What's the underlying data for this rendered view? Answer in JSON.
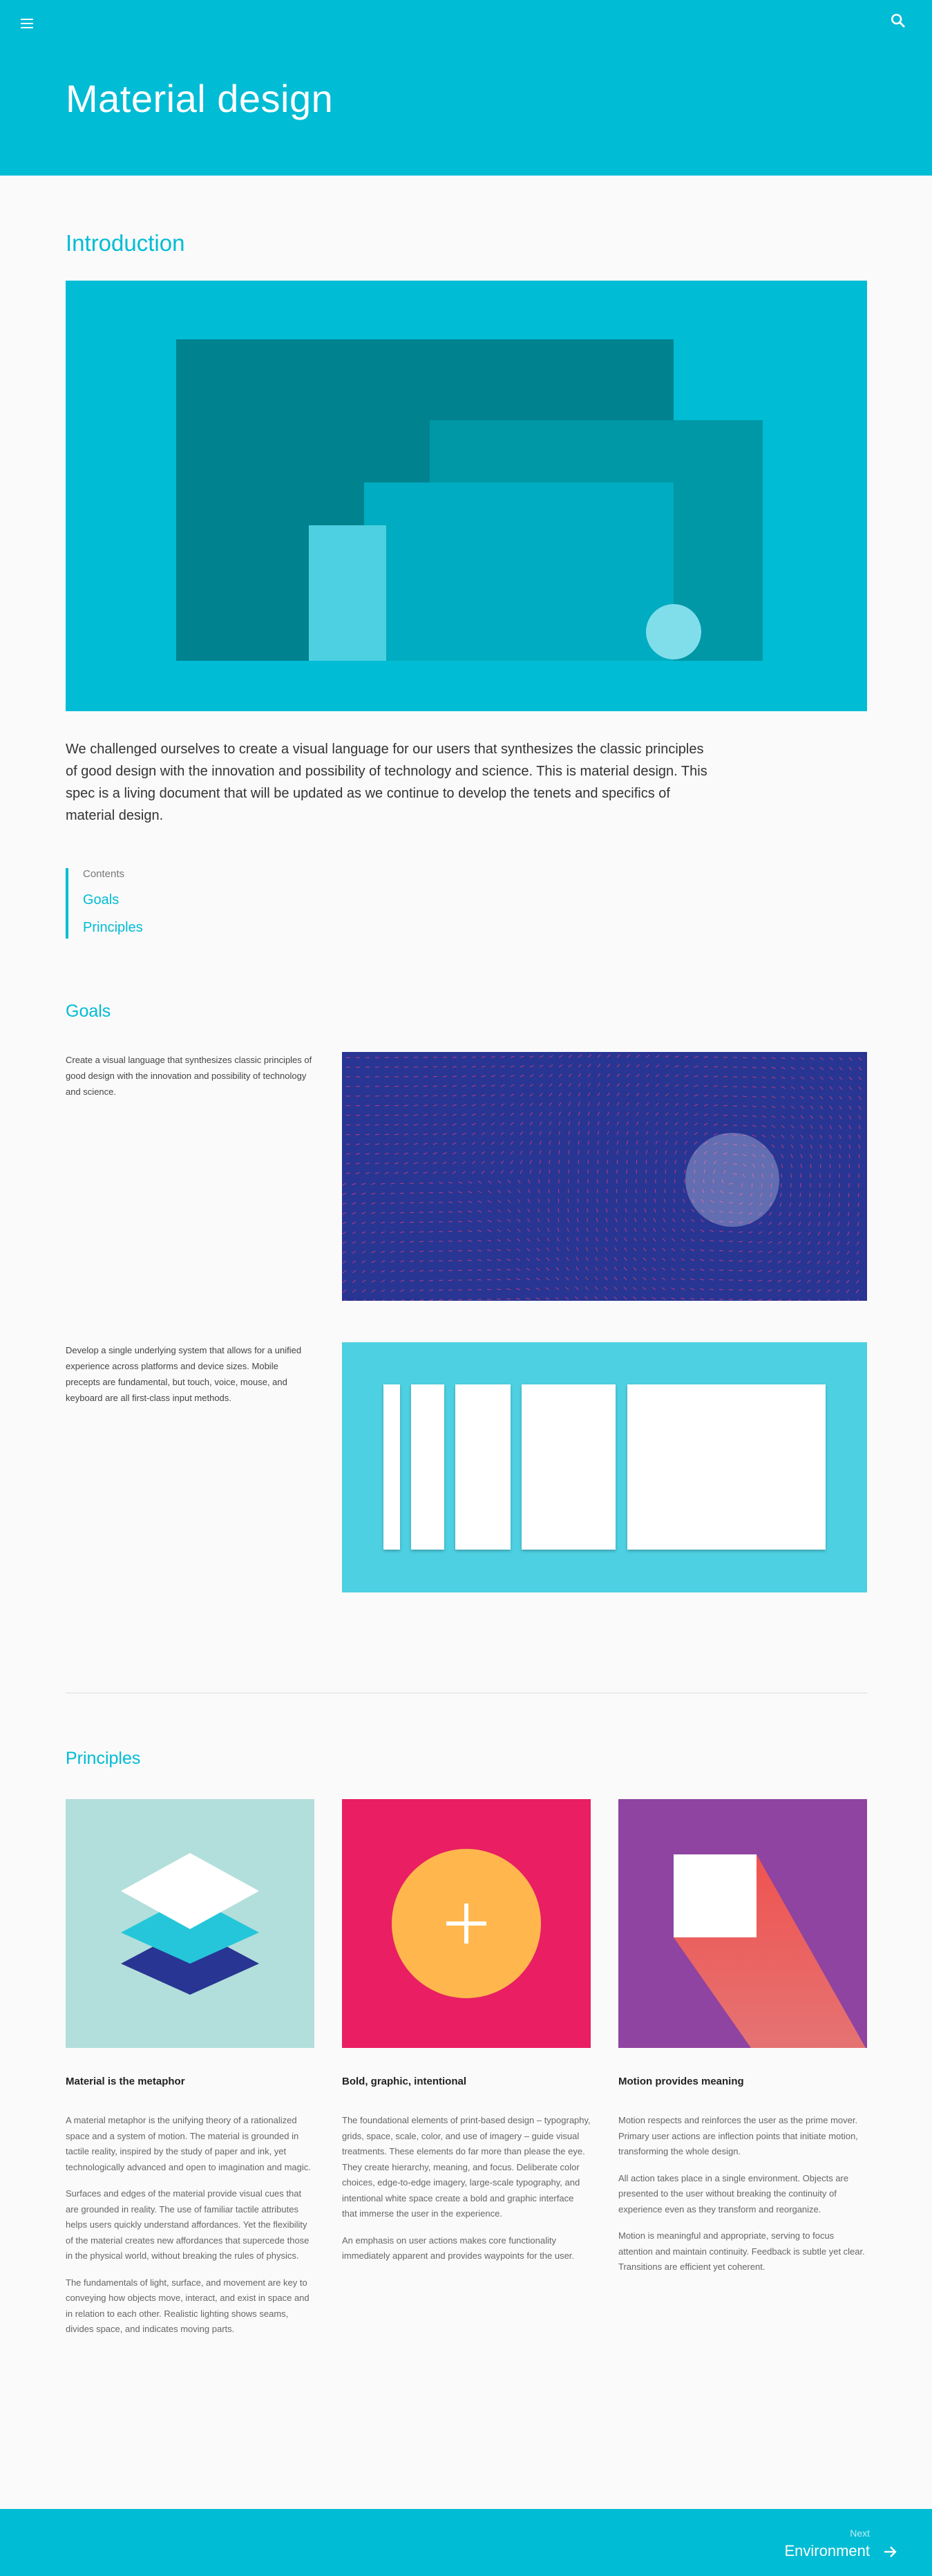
{
  "header": {
    "title": "Material design",
    "menu_icon": "menu-icon",
    "search_icon": "search-icon"
  },
  "intro": {
    "title": "Introduction",
    "paragraph": "We challenged ourselves to create a visual language for our users that synthesizes the classic principles of good design with the innovation and possibility of technology and science. This is material design. This spec is a living document that will be updated as we continue to develop the tenets and specifics of material design."
  },
  "toc": {
    "heading": "Contents",
    "items": [
      "Goals",
      "Principles"
    ]
  },
  "goals": {
    "title": "Goals",
    "items": [
      "Create a visual language that synthesizes classic principles of good design with the innovation and possibility of technology and science.",
      "Develop a single underlying system that allows for a unified experience across platforms and device sizes. Mobile precepts are fundamental, but touch, voice, mouse, and keyboard are all first-class input methods."
    ]
  },
  "principles": {
    "title": "Principles",
    "items": [
      {
        "title": "Material is the metaphor",
        "paragraphs": [
          "A material metaphor is the unifying theory of a rationalized space and a system of motion. The material is grounded in tactile reality, inspired by the study of paper and ink, yet technologically advanced and open to imagination and magic.",
          "Surfaces and edges of the material provide visual cues that are grounded in reality. The use of familiar tactile attributes helps users quickly understand affordances. Yet the flexibility of the material creates new affordances that supercede those in the physical world, without breaking the rules of physics.",
          "The fundamentals of light, surface, and movement are key to conveying how objects move, interact, and exist in space and in relation to each other. Realistic lighting shows seams, divides space, and indicates moving parts."
        ]
      },
      {
        "title": "Bold, graphic, intentional",
        "paragraphs": [
          "The foundational elements of print-based design – typography, grids, space, scale, color, and use of imagery – guide visual treatments. These elements do far more than please the eye. They create hierarchy, meaning, and focus. Deliberate color choices, edge-to-edge imagery, large-scale typography, and intentional white space create a bold and graphic interface that immerse the user in the experience.",
          "An emphasis on user actions makes core functionality immediately apparent and provides waypoints for the user."
        ]
      },
      {
        "title": "Motion provides meaning",
        "paragraphs": [
          "Motion respects and reinforces the user as the prime mover. Primary user actions are inflection points that initiate motion, transforming the whole design.",
          "All action takes place in a single environment. Objects are presented to the user without breaking the continuity of experience even as they transform and reorganize.",
          "Motion is meaningful and appropriate, serving to focus attention and maintain continuity. Feedback is subtle yet clear. Transitions are efficient yet coherent."
        ]
      }
    ]
  },
  "footer": {
    "next_label": "Next",
    "next_title": "Environment",
    "arrow_icon": "arrow-right-icon"
  },
  "colors": {
    "primary": "#00bcd4",
    "goal1_bg": "#283593",
    "principle_pink": "#e91e63",
    "principle_purple": "#8e44a0"
  }
}
